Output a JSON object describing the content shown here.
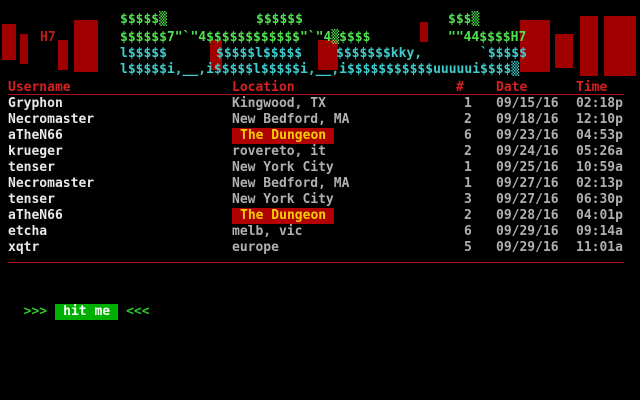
{
  "banner": {
    "line1": {
      "a": "$$$$$▒",
      "b": "$$$$$$",
      "c": "$$$▒"
    },
    "line2": {
      "a": "H7",
      "b": "$$$$$$7\"`\"4$$$$$$$$$$$$\"`\"4▒$$$$",
      "c": "\"\"44$$$$H7"
    },
    "line3": {
      "a": "l$$$$$",
      "b": "$$$$$l$$$$$",
      "c": "$$$$$$$kky,",
      "d": "`$$$$$"
    },
    "line4": {
      "a": "l$$$$$i,__,i$$$$$l$$$$$i,__,i$$$$$$$$$$$uuuuui$$$$▒"
    }
  },
  "table": {
    "headers": {
      "username": "Username",
      "location": "Location",
      "number": "#",
      "date": "Date",
      "time": "Time"
    },
    "rows": [
      {
        "user": "Gryphon",
        "location": "Kingwood, TX",
        "num": "1",
        "date": "09/15/16",
        "time": "02:18p",
        "highlight": false
      },
      {
        "user": "Necromaster",
        "location": "New Bedford, MA",
        "num": "2",
        "date": "09/18/16",
        "time": "12:10p",
        "highlight": false
      },
      {
        "user": "aTheN66",
        "location": "The Dungeon",
        "num": "6",
        "date": "09/23/16",
        "time": "04:53p",
        "highlight": true
      },
      {
        "user": "krueger",
        "location": "rovereto, it",
        "num": "2",
        "date": "09/24/16",
        "time": "05:26a",
        "highlight": false
      },
      {
        "user": "tenser",
        "location": "New York City",
        "num": "1",
        "date": "09/25/16",
        "time": "10:59a",
        "highlight": false
      },
      {
        "user": "Necromaster",
        "location": "New Bedford, MA",
        "num": "1",
        "date": "09/27/16",
        "time": "02:13p",
        "highlight": false
      },
      {
        "user": "tenser",
        "location": "New York City",
        "num": "3",
        "date": "09/27/16",
        "time": "06:30p",
        "highlight": false
      },
      {
        "user": "aTheN66",
        "location": "The Dungeon",
        "num": "2",
        "date": "09/28/16",
        "time": "04:01p",
        "highlight": true
      },
      {
        "user": "etcha",
        "location": "melb, vic",
        "num": "6",
        "date": "09/29/16",
        "time": "09:14a",
        "highlight": false
      },
      {
        "user": "xqtr",
        "location": "europe",
        "num": "5",
        "date": "09/29/16",
        "time": "11:01a",
        "highlight": false
      }
    ]
  },
  "prompt": {
    "left_arrows": ">>>",
    "button_label": "hit me",
    "right_arrows": "<<<"
  }
}
